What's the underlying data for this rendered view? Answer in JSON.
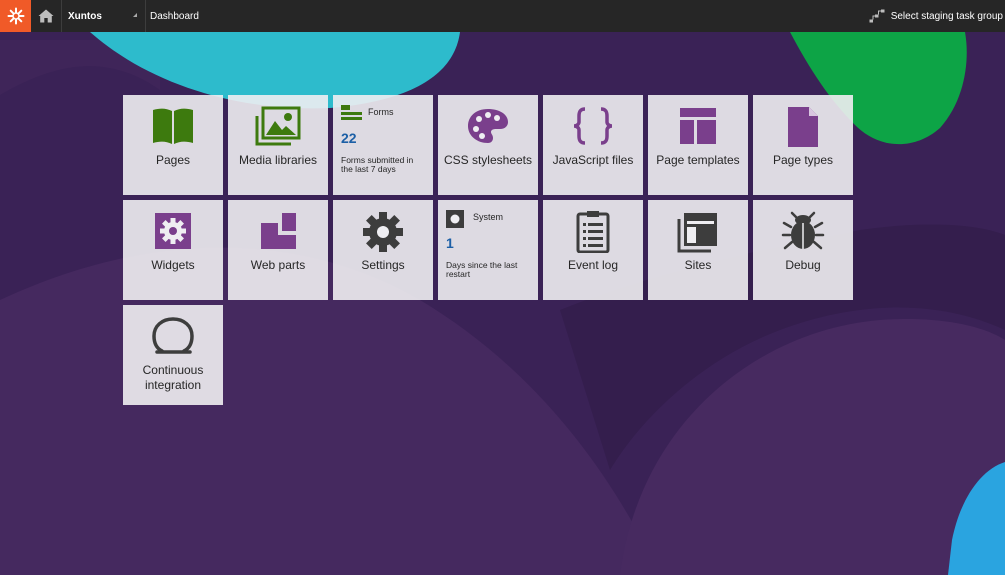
{
  "header": {
    "site_name": "Xuntos",
    "breadcrumb": "Dashboard",
    "staging_label": "Select staging task group"
  },
  "colors": {
    "topbar": "#262626",
    "logo": "#f05a28",
    "tile_bg": "#efeef2",
    "green_icon": "#3d7a0e",
    "purple_icon": "#7a3f8c",
    "dark_icon": "#3d3d3d",
    "widget_number": "#1c5fa6"
  },
  "tiles": [
    {
      "label": "Pages",
      "icon": "book-icon"
    },
    {
      "label": "Media libraries",
      "icon": "image-icon"
    },
    {
      "label": "CSS stylesheets",
      "icon": "palette-icon"
    },
    {
      "label": "JavaScript files",
      "icon": "curly-braces-icon"
    },
    {
      "label": "Page templates",
      "icon": "layout-template-icon"
    },
    {
      "label": "Page types",
      "icon": "document-icon"
    },
    {
      "label": "Widgets",
      "icon": "widget-gear-icon"
    },
    {
      "label": "Web parts",
      "icon": "web-part-icon"
    },
    {
      "label": "Settings",
      "icon": "gear-icon"
    },
    {
      "label": "Event log",
      "icon": "clipboard-list-icon"
    },
    {
      "label": "Sites",
      "icon": "sites-icon"
    },
    {
      "label": "Debug",
      "icon": "bug-icon"
    },
    {
      "label": "Continuous integration",
      "icon": "ci-loop-icon"
    }
  ],
  "widgets": {
    "forms": {
      "title": "Forms",
      "value": "22",
      "description": "Forms submitted in the last 7 days",
      "icon": "forms-icon"
    },
    "system": {
      "title": "System",
      "value": "1",
      "description": "Days since the last restart",
      "icon": "system-icon"
    }
  }
}
